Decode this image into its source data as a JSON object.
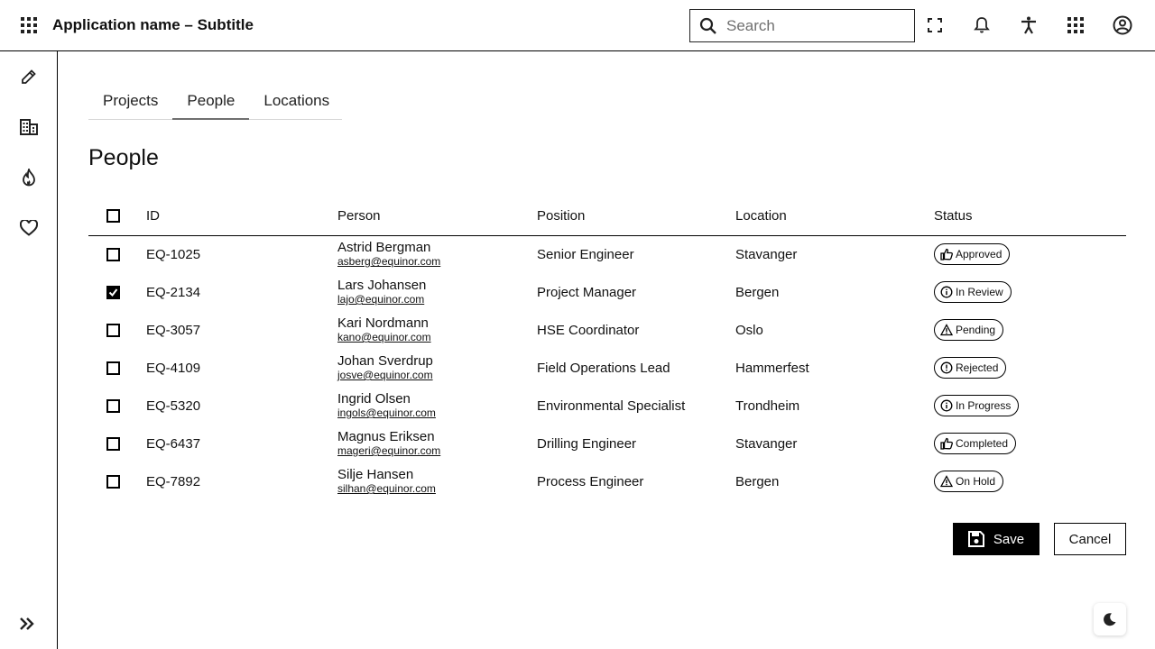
{
  "header": {
    "title": "Application name – Subtitle",
    "search_placeholder": "Search",
    "search_value": "",
    "icons": [
      "grid-menu-icon",
      "fullscreen-icon",
      "notification-bell-icon",
      "accessibility-icon",
      "apps-grid-icon",
      "account-icon"
    ]
  },
  "sidebar": {
    "items": [
      {
        "icon": "edit-icon"
      },
      {
        "icon": "building-icon"
      },
      {
        "icon": "flame-icon"
      },
      {
        "icon": "heart-icon"
      }
    ],
    "expand_icon": "double-chevron-right-icon"
  },
  "tabs": [
    {
      "label": "Projects",
      "active": false
    },
    {
      "label": "People",
      "active": true
    },
    {
      "label": "Locations",
      "active": false
    }
  ],
  "page_title": "People",
  "table": {
    "headers": {
      "id": "ID",
      "person": "Person",
      "position": "Position",
      "location": "Location",
      "status": "Status"
    },
    "rows": [
      {
        "checked": false,
        "id": "EQ-1025",
        "name": "Astrid Bergman",
        "email": "asberg@equinor.com",
        "position": "Senior Engineer",
        "location": "Stavanger",
        "status": "Approved",
        "status_icon": "thumbs-up-icon"
      },
      {
        "checked": true,
        "id": "EQ-2134",
        "name": "Lars Johansen",
        "email": "lajo@equinor.com",
        "position": "Project Manager",
        "location": "Bergen",
        "status": "In Review",
        "status_icon": "info-circle-icon"
      },
      {
        "checked": false,
        "id": "EQ-3057",
        "name": "Kari Nordmann",
        "email": "kano@equinor.com",
        "position": "HSE Coordinator",
        "location": "Oslo",
        "status": "Pending",
        "status_icon": "warning-triangle-icon"
      },
      {
        "checked": false,
        "id": "EQ-4109",
        "name": "Johan Sverdrup",
        "email": "josve@equinor.com",
        "position": "Field Operations Lead",
        "location": "Hammerfest",
        "status": "Rejected",
        "status_icon": "error-circle-icon"
      },
      {
        "checked": false,
        "id": "EQ-5320",
        "name": "Ingrid Olsen",
        "email": "ingols@equinor.com",
        "position": "Environmental Specialist",
        "location": "Trondheim",
        "status": "In Progress",
        "status_icon": "info-circle-icon"
      },
      {
        "checked": false,
        "id": "EQ-6437",
        "name": "Magnus Eriksen",
        "email": "mageri@equinor.com",
        "position": "Drilling Engineer",
        "location": "Stavanger",
        "status": "Completed",
        "status_icon": "thumbs-up-icon"
      },
      {
        "checked": false,
        "id": "EQ-7892",
        "name": "Silje Hansen",
        "email": "silhan@equinor.com",
        "position": "Process Engineer",
        "location": "Bergen",
        "status": "On Hold",
        "status_icon": "warning-triangle-icon"
      }
    ]
  },
  "actions": {
    "save_label": "Save",
    "cancel_label": "Cancel"
  },
  "theme_toggle_icon": "moon-icon"
}
